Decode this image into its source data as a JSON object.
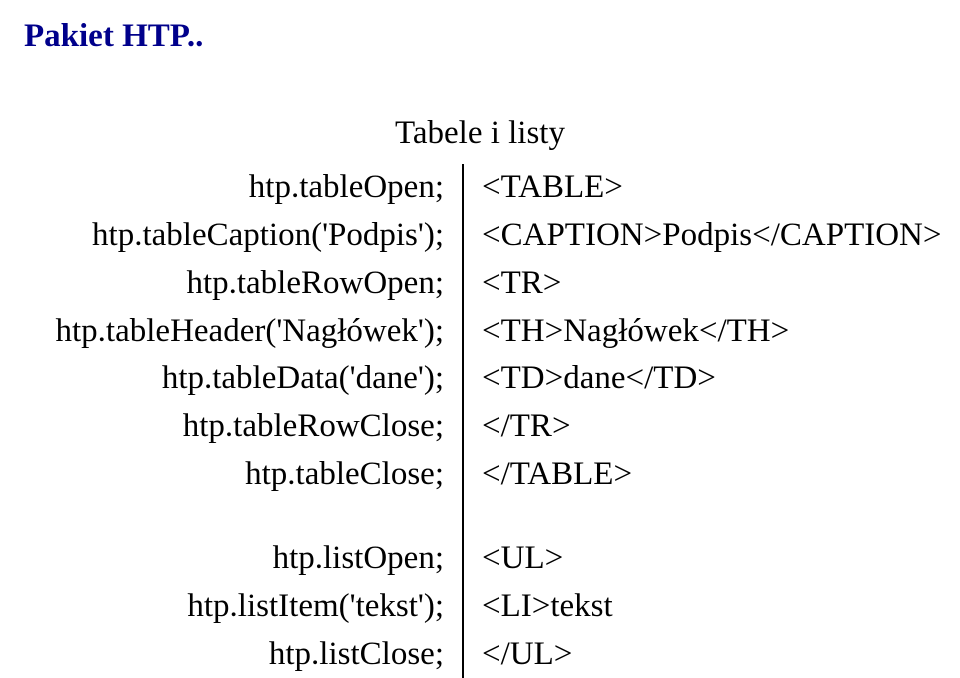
{
  "title": "Pakiet HTP..",
  "subtitle": "Tabele i listy",
  "table_block": {
    "left": [
      "htp.tableOpen;",
      "htp.tableCaption('Podpis');",
      "htp.tableRowOpen;",
      "htp.tableHeader('Nagłówek');",
      "htp.tableData('dane');",
      "htp.tableRowClose;",
      "htp.tableClose;"
    ],
    "right": [
      "<TABLE>",
      "<CAPTION>Podpis</CAPTION>",
      "<TR>",
      "<TH>Nagłówek</TH>",
      "<TD>dane</TD>",
      "</TR>",
      "</TABLE>"
    ]
  },
  "list_block": {
    "left": [
      "htp.listOpen;",
      "htp.listItem('tekst');",
      "htp.listClose;"
    ],
    "right": [
      "<UL>",
      "<LI>tekst",
      "</UL>"
    ]
  }
}
